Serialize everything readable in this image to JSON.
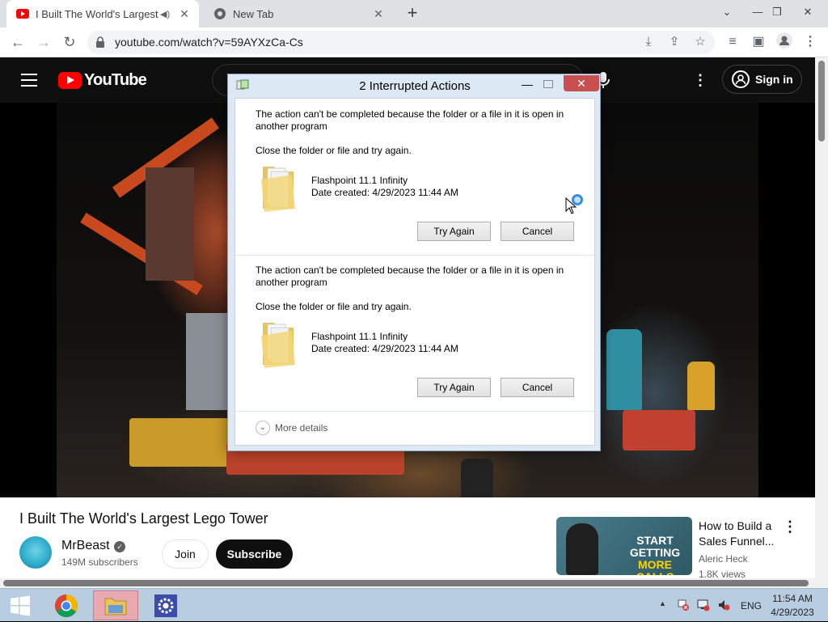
{
  "browser": {
    "tabs": [
      {
        "title": "I Built The World's Largest Le",
        "active": true,
        "favicon": "youtube-favicon",
        "audio": true
      },
      {
        "title": "New Tab",
        "active": false,
        "favicon": "chrome-favicon"
      }
    ],
    "url": "youtube.com/watch?v=59AYXzCa-Cs"
  },
  "youtube": {
    "logo_text": "YouTube",
    "sign_in": "Sign in",
    "video_title": "I Built The World's Largest Lego Tower",
    "channel_name": "MrBeast",
    "subscribers": "149M subscribers",
    "join": "Join",
    "subscribe": "Subscribe",
    "recommendation": {
      "title": "How to Build a Sales Funnel...",
      "channel": "Aleric Heck",
      "views": "1.8K views",
      "thumb_line1": "START",
      "thumb_line2": "GETTING",
      "thumb_line3": "MORE CALLS"
    }
  },
  "dialog": {
    "title": "2 Interrupted Actions",
    "conflicts": [
      {
        "message": "The action can't be completed because the folder or a file in it is open in another program",
        "instruction": "Close the folder or file and try again.",
        "file_name": "Flashpoint 11.1 Infinity",
        "date_created": "Date created: 4/29/2023 11:44 AM",
        "try_again": "Try Again",
        "cancel": "Cancel"
      },
      {
        "message": "The action can't be completed because the folder or a file in it is open in another program",
        "instruction": "Close the folder or file and try again.",
        "file_name": "Flashpoint 11.1 Infinity",
        "date_created": "Date created: 4/29/2023 11:44 AM",
        "try_again": "Try Again",
        "cancel": "Cancel"
      }
    ],
    "more_details": "More details"
  },
  "taskbar": {
    "language": "ENG",
    "time": "11:54 AM",
    "date": "4/29/2023"
  },
  "colors": {
    "youtube_red": "#ff0000",
    "dialog_frame": "#dce9f5",
    "taskbar": "#b8cde0"
  }
}
